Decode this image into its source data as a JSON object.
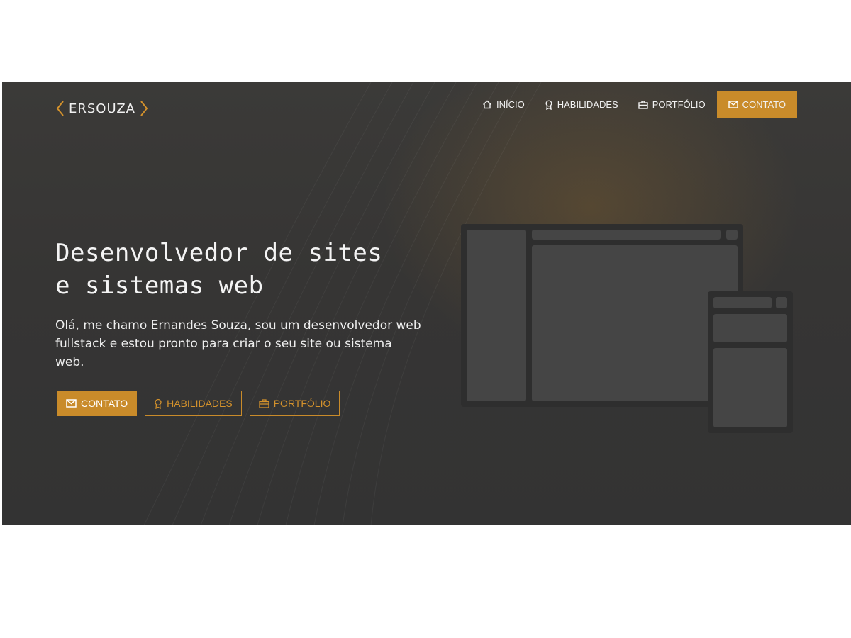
{
  "brand": {
    "name": "ERSOUZA",
    "accent_color": "#d4922c"
  },
  "nav": {
    "items": [
      {
        "label": "INÍCIO",
        "icon": "home-icon"
      },
      {
        "label": "HABILIDADES",
        "icon": "award-icon"
      },
      {
        "label": "PORTFÓLIO",
        "icon": "briefcase-icon"
      },
      {
        "label": "CONTATO",
        "icon": "mail-icon",
        "active": true
      }
    ]
  },
  "hero": {
    "headline_line1": "Desenvolvedor de sites",
    "headline_line2": "e sistemas web",
    "intro": "Olá, me chamo Ernandes Souza, sou um desenvolvedor web fullstack e estou pronto para criar o seu site ou sistema web.",
    "buttons": [
      {
        "label": "CONTATO",
        "icon": "mail-icon",
        "style": "solid"
      },
      {
        "label": "HABILIDADES",
        "icon": "award-icon",
        "style": "outline"
      },
      {
        "label": "PORTFÓLIO",
        "icon": "briefcase-icon",
        "style": "outline"
      }
    ]
  },
  "colors": {
    "background": "#363534",
    "accent": "#c98b2a",
    "text": "#f4f4f4",
    "illustration": "#454545"
  }
}
